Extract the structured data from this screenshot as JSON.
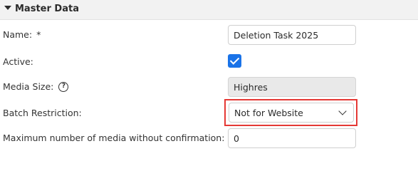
{
  "section": {
    "title": "Master Data"
  },
  "fields": {
    "name": {
      "label": "Name:",
      "required_marker": "*",
      "value": "Deletion Task 2025"
    },
    "active": {
      "label": "Active:",
      "checked": true
    },
    "media_size": {
      "label": "Media Size:",
      "help_glyph": "?",
      "value": "Highres"
    },
    "batch_restriction": {
      "label": "Batch Restriction:",
      "selected": "Not for Website"
    },
    "max_media": {
      "label": "Maximum number of media without confirmation:",
      "required_marker": "*",
      "help_glyph": "?",
      "value": "0"
    }
  },
  "colors": {
    "accent": "#1a73e8",
    "highlight": "#e53935",
    "header_bg": "#f2f2f2"
  }
}
